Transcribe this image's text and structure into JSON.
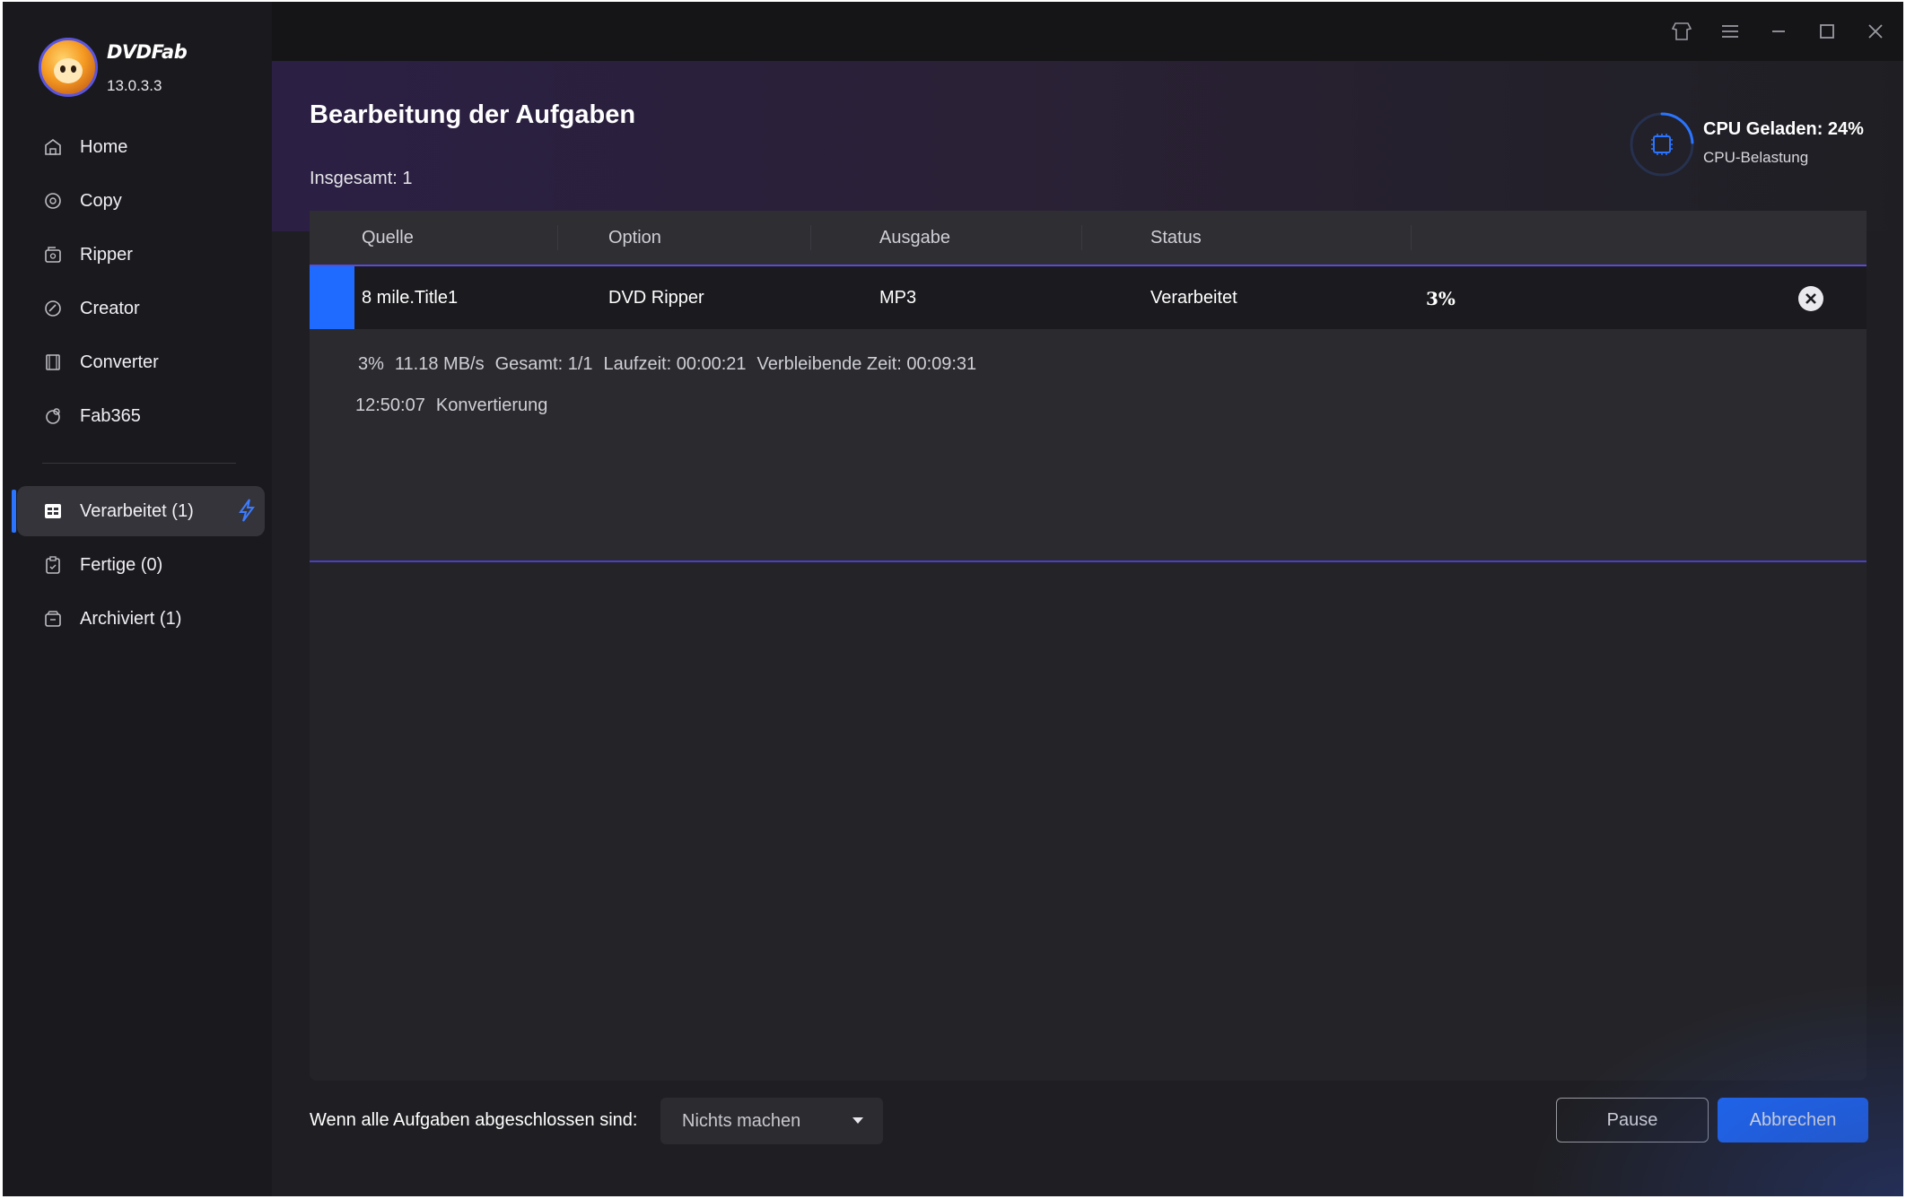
{
  "app": {
    "brand": "DVDFab",
    "version": "13.0.3.3"
  },
  "sidebar": {
    "items": [
      {
        "label": "Home",
        "icon": "home-icon"
      },
      {
        "label": "Copy",
        "icon": "copy-icon"
      },
      {
        "label": "Ripper",
        "icon": "ripper-icon"
      },
      {
        "label": "Creator",
        "icon": "creator-icon"
      },
      {
        "label": "Converter",
        "icon": "converter-icon"
      },
      {
        "label": "Fab365",
        "icon": "fab365-icon"
      }
    ],
    "tasks": [
      {
        "label": "Verarbeitet (1)",
        "icon": "processing-icon",
        "active": true
      },
      {
        "label": "Fertige (0)",
        "icon": "finished-icon"
      },
      {
        "label": "Archiviert (1)",
        "icon": "archive-icon"
      }
    ]
  },
  "header": {
    "title": "Bearbeitung der Aufgaben",
    "total": "Insgesamt: 1"
  },
  "cpu": {
    "title": "CPU Geladen: 24%",
    "subtitle": "CPU-Belastung",
    "load_percent": 24
  },
  "table": {
    "columns": [
      "Quelle",
      "Option",
      "Ausgabe",
      "Status"
    ],
    "row": {
      "source": "8 mile.Title1",
      "option": "DVD Ripper",
      "output": "MP3",
      "status": "Verarbeitet",
      "progress": "3%"
    },
    "detail": {
      "percent": "3%",
      "speed": "11.18 MB/s",
      "total": "Gesamt: 1/1",
      "elapsed": "Laufzeit: 00:00:21",
      "remaining": "Verbleibende Zeit: 00:09:31",
      "time": "12:50:07",
      "step": "Konvertierung"
    }
  },
  "footer": {
    "label": "Wenn alle Aufgaben abgeschlossen sind:",
    "select_value": "Nichts machen",
    "pause_label": "Pause",
    "cancel_label": "Abbrechen"
  },
  "colors": {
    "accent": "#1e6bff",
    "row_border": "#5b4bd6"
  }
}
